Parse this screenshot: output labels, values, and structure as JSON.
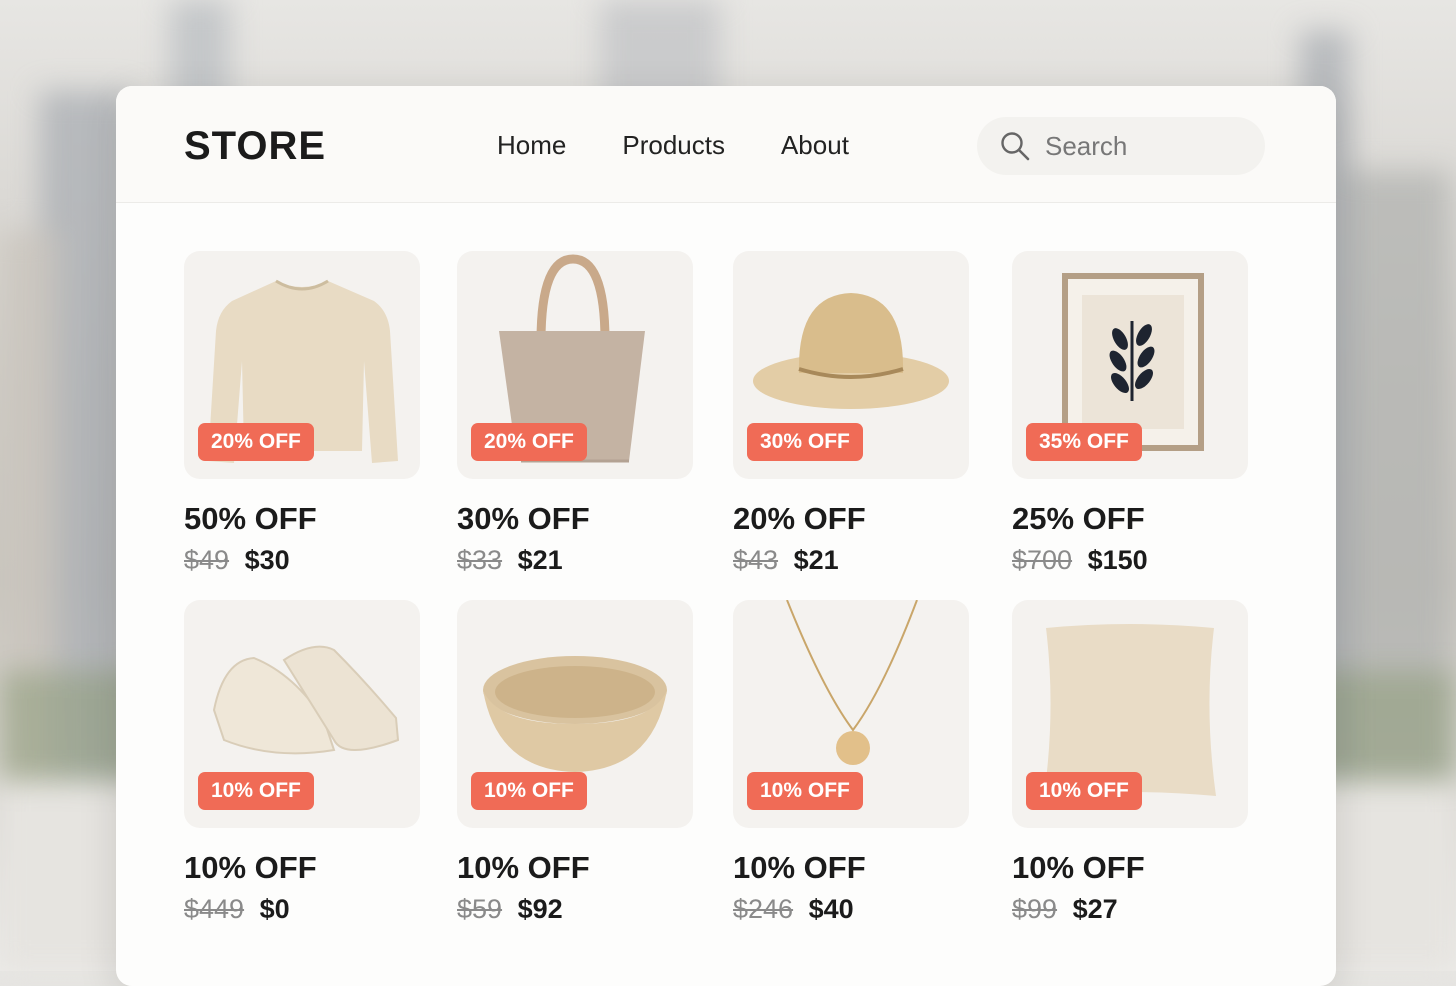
{
  "header": {
    "logo": "STORE",
    "nav": [
      "Home",
      "Products",
      "About"
    ],
    "search_placeholder": "Search"
  },
  "products": [
    {
      "badge": "20% OFF",
      "title": "50% OFF",
      "old_price": "$49",
      "price": "$30",
      "image": "sweater"
    },
    {
      "badge": "20% OFF",
      "title": "30% OFF",
      "old_price": "$33",
      "price": "$21",
      "image": "tote-bag"
    },
    {
      "badge": "30% OFF",
      "title": "20% OFF",
      "old_price": "$43",
      "price": "$21",
      "image": "hat"
    },
    {
      "badge": "35% OFF",
      "title": "25% OFF",
      "old_price": "$700",
      "price": "$150",
      "image": "framed-print"
    },
    {
      "badge": "10% OFF",
      "title": "10% OFF",
      "old_price": "$449",
      "price": "$0",
      "image": "sneakers"
    },
    {
      "badge": "10% OFF",
      "title": "10% OFF",
      "old_price": "$59",
      "price": "$92",
      "image": "bowl"
    },
    {
      "badge": "10% OFF",
      "title": "10% OFF",
      "old_price": "$246",
      "price": "$40",
      "image": "necklace"
    },
    {
      "badge": "10% OFF",
      "title": "10% OFF",
      "old_price": "$99",
      "price": "$27",
      "image": "pillow"
    }
  ],
  "colors": {
    "badge": "#f06b56",
    "accent_beige": "#e3d6bf"
  }
}
